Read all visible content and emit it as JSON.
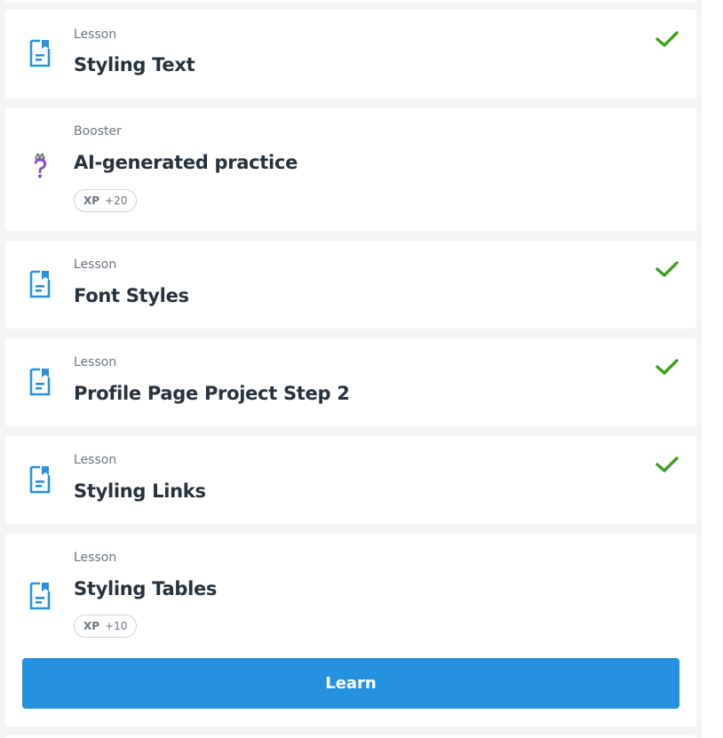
{
  "items": [
    {
      "kind": "Lesson",
      "title": "Styling Text",
      "completed": true,
      "icon": "lesson-doc-icon"
    },
    {
      "kind": "Booster",
      "title": "AI-generated practice",
      "xp_label": "XP",
      "xp_value": "+20",
      "icon": "question-mascot-icon"
    },
    {
      "kind": "Lesson",
      "title": "Font Styles",
      "completed": true,
      "icon": "lesson-doc-icon"
    },
    {
      "kind": "Lesson",
      "title": "Profile Page Project Step 2",
      "completed": true,
      "icon": "lesson-doc-icon"
    },
    {
      "kind": "Lesson",
      "title": "Styling Links",
      "completed": true,
      "icon": "lesson-doc-icon"
    },
    {
      "kind": "Lesson",
      "title": "Styling Tables",
      "xp_label": "XP",
      "xp_value": "+10",
      "icon": "lesson-doc-icon",
      "action_label": "Learn"
    }
  ],
  "colors": {
    "accent": "#2592e0",
    "check": "#3aa11d",
    "title": "#27323d",
    "muted": "#6b7580",
    "mascot": "#8a4cd1"
  }
}
